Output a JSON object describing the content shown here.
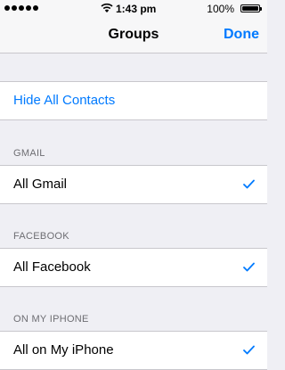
{
  "status_bar": {
    "time": "1:43 pm",
    "battery_percent": "100%",
    "battery_level": 1.0,
    "signal_dots": 5
  },
  "nav": {
    "title": "Groups",
    "done_label": "Done"
  },
  "hide_all": {
    "label": "Hide All Contacts"
  },
  "sections": [
    {
      "header": "GMAIL",
      "item": "All Gmail",
      "checked": true
    },
    {
      "header": "FACEBOOK",
      "item": "All Facebook",
      "checked": true
    },
    {
      "header": "ON MY IPHONE",
      "item": "All on My iPhone",
      "checked": true
    }
  ],
  "colors": {
    "accent": "#007aff",
    "background": "#efeff4",
    "header_text": "#6d6d72"
  },
  "icons": {
    "wifi": "wifi-icon",
    "battery": "battery-icon",
    "check": "checkmark-icon"
  }
}
